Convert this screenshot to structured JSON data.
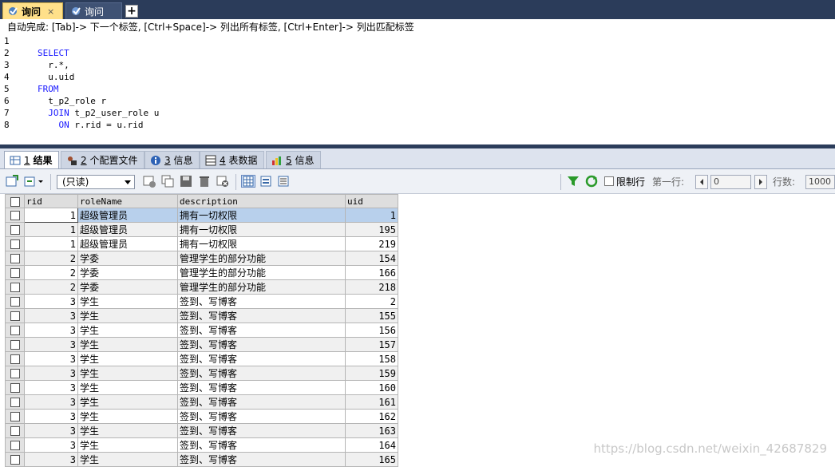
{
  "query_tabs": [
    {
      "label": "询问",
      "close": "×",
      "active": true
    },
    {
      "label": "询问",
      "active": false
    }
  ],
  "new_tab_label": "+",
  "hint": "自动完成: [Tab]-> 下一个标签, [Ctrl+Space]-> 列出所有标签, [Ctrl+Enter]-> 列出匹配标签",
  "editor": {
    "line_numbers": [
      "1",
      "2",
      "3",
      "4",
      "5",
      "6",
      "7",
      "8"
    ],
    "lines": [
      {
        "indent": "",
        "kw": "",
        "text": ""
      },
      {
        "indent": "",
        "kw": "SELECT",
        "text": ""
      },
      {
        "indent": "  ",
        "kw": "",
        "text": "r.*,"
      },
      {
        "indent": "  ",
        "kw": "",
        "text": "u.uid"
      },
      {
        "indent": "",
        "kw": "FROM",
        "text": ""
      },
      {
        "indent": "  ",
        "kw": "",
        "text": "t_p2_role r"
      },
      {
        "indent": "  ",
        "kw": "JOIN",
        "text": " t_p2_user_role u"
      },
      {
        "indent": "    ",
        "kw": "ON",
        "text": " r.rid = u.rid"
      }
    ]
  },
  "result_tabs": [
    {
      "num": "1",
      "label": "结果",
      "icon": "result-grid-icon",
      "active": true
    },
    {
      "num": "2",
      "label": "个配置文件",
      "icon": "profile-icon",
      "active": false
    },
    {
      "num": "3",
      "label": "信息",
      "icon": "info-icon",
      "active": false
    },
    {
      "num": "4",
      "label": "表数据",
      "icon": "table-data-icon",
      "active": false
    },
    {
      "num": "5",
      "label": "信息",
      "icon": "info-chart-icon",
      "active": false
    }
  ],
  "toolbar": {
    "readonly_select": "(只读)",
    "limit_rows_label": "限制行",
    "first_row_label": "第一行:",
    "first_row_value": "0",
    "rows_label": "行数:",
    "rows_value": "1000"
  },
  "grid": {
    "columns": [
      "rid",
      "roleName",
      "description",
      "uid"
    ],
    "rows": [
      [
        "1",
        "超级管理员",
        "拥有一切权限",
        "1"
      ],
      [
        "1",
        "超级管理员",
        "拥有一切权限",
        "195"
      ],
      [
        "1",
        "超级管理员",
        "拥有一切权限",
        "219"
      ],
      [
        "2",
        "学委",
        "管理学生的部分功能",
        "154"
      ],
      [
        "2",
        "学委",
        "管理学生的部分功能",
        "166"
      ],
      [
        "2",
        "学委",
        "管理学生的部分功能",
        "218"
      ],
      [
        "3",
        "学生",
        "签到、写博客",
        "2"
      ],
      [
        "3",
        "学生",
        "签到、写博客",
        "155"
      ],
      [
        "3",
        "学生",
        "签到、写博客",
        "156"
      ],
      [
        "3",
        "学生",
        "签到、写博客",
        "157"
      ],
      [
        "3",
        "学生",
        "签到、写博客",
        "158"
      ],
      [
        "3",
        "学生",
        "签到、写博客",
        "159"
      ],
      [
        "3",
        "学生",
        "签到、写博客",
        "160"
      ],
      [
        "3",
        "学生",
        "签到、写博客",
        "161"
      ],
      [
        "3",
        "学生",
        "签到、写博客",
        "162"
      ],
      [
        "3",
        "学生",
        "签到、写博客",
        "163"
      ],
      [
        "3",
        "学生",
        "签到、写博客",
        "164"
      ],
      [
        "3",
        "学生",
        "签到、写博客",
        "165"
      ]
    ]
  },
  "watermark": "https://blog.csdn.net/weixin_42687829",
  "colors": {
    "tab_bar": "#2b3c5a",
    "active_tab": "#ffe08a",
    "keyword": "#1a1aff",
    "selected_row": "#b8d0ec"
  }
}
